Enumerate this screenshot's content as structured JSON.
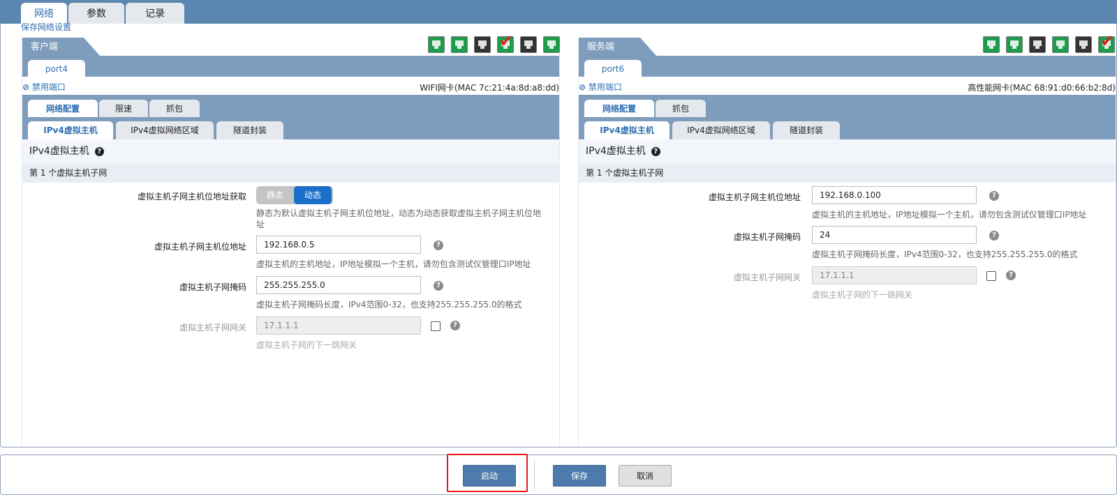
{
  "main_tabs": [
    "网络",
    "参数",
    "记录"
  ],
  "save_network_link": "保存网络设置",
  "client": {
    "title": "客户端",
    "port": "port4",
    "disable_port": "禁用端口",
    "nic_info": "WIFI网卡(MAC 7c:21:4a:8d:a8:dd)",
    "ports": [
      {
        "color": "green"
      },
      {
        "color": "green"
      },
      {
        "color": "black"
      },
      {
        "color": "green",
        "checked": true
      },
      {
        "color": "black"
      },
      {
        "color": "green"
      }
    ],
    "tabs": [
      "网络配置",
      "限速",
      "抓包"
    ],
    "subtabs": [
      "IPv4虚拟主机",
      "IPv4虚拟网络区域",
      "隧道封装"
    ],
    "section_title": "IPv4虚拟主机",
    "subnet_title": "第 1 个虚拟主机子网",
    "mode_label": "虚拟主机子网主机位地址获取",
    "mode_options": [
      "静态",
      "动态"
    ],
    "mode_selected": "动态",
    "mode_hint": "静态为默认虚拟主机子网主机位地址，动态为动态获取虚拟主机子网主机位地址",
    "host_label": "虚拟主机子网主机位地址",
    "host_value": "192.168.0.5",
    "host_hint": "虚拟主机的主机地址，IP地址模拟一个主机，请勿包含测试仪管理口IP地址",
    "mask_label": "虚拟主机子网掩码",
    "mask_value": "255.255.255.0",
    "mask_hint": "虚拟主机子网掩码长度，IPv4范围0-32，也支持255.255.255.0的格式",
    "gw_label": "虚拟主机子网网关",
    "gw_value": "17.1.1.1",
    "gw_hint": "虚拟主机子网的下一跳网关"
  },
  "server": {
    "title": "服务端",
    "port": "port6",
    "disable_port": "禁用端口",
    "nic_info": "高性能网卡(MAC 68:91:d0:66:b2:8d)",
    "ports": [
      {
        "color": "green"
      },
      {
        "color": "green"
      },
      {
        "color": "black"
      },
      {
        "color": "green"
      },
      {
        "color": "black"
      },
      {
        "color": "green",
        "checked": true
      }
    ],
    "tabs": [
      "网络配置",
      "抓包"
    ],
    "subtabs": [
      "IPv4虚拟主机",
      "IPv4虚拟网络区域",
      "隧道封装"
    ],
    "section_title": "IPv4虚拟主机",
    "subnet_title": "第 1 个虚拟主机子网",
    "host_label": "虚拟主机子网主机位地址",
    "host_value": "192.168.0.100",
    "host_hint": "虚拟主机的主机地址，IP地址模拟一个主机，请勿包含测试仪管理口IP地址",
    "mask_label": "虚拟主机子网掩码",
    "mask_value": "24",
    "mask_hint": "虚拟主机子网掩码长度，IPv4范围0-32，也支持255.255.255.0的格式",
    "gw_label": "虚拟主机子网网关",
    "gw_value": "17.1.1.1",
    "gw_hint": "虚拟主机子网的下一跳网关"
  },
  "footer": {
    "start": "启动",
    "save": "保存",
    "cancel": "取消"
  },
  "colors": {
    "header": "#5b86b0",
    "panel_bar": "#7e9cbb",
    "link": "#2f6fb2",
    "primary_button": "#4d7bab",
    "toggle_active": "#1a6fc9",
    "highlight_box": "#e81818"
  }
}
